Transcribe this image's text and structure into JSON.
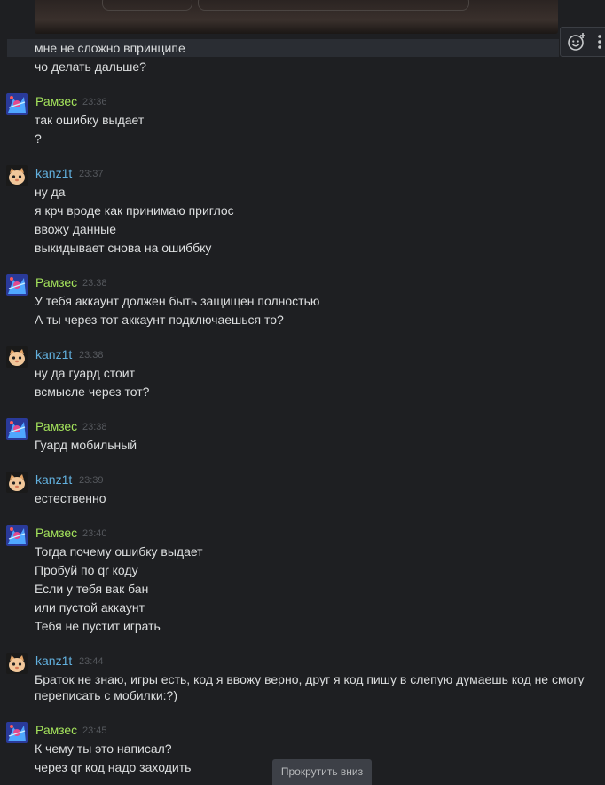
{
  "messages_top": [
    {
      "text": "мне не сложно впринципе"
    },
    {
      "text": "чо делать дальше?"
    }
  ],
  "groups": [
    {
      "author": "Рамзес",
      "time": "23:36",
      "lines": [
        "так ошибку выдает",
        "?"
      ]
    },
    {
      "author": "kanz1t",
      "time": "23:37",
      "lines": [
        "ну да",
        "я крч вроде как принимаю приглос",
        "ввожу данные",
        "выкидывает снова на ошиббку"
      ]
    },
    {
      "author": "Рамзес",
      "time": "23:38",
      "lines": [
        "У тебя аккаунт должен быть защищен полностью",
        "А ты через тот аккаунт подключаешься то?"
      ]
    },
    {
      "author": "kanz1t",
      "time": "23:38",
      "lines": [
        "ну да гуард стоит",
        "всмысле через тот?"
      ]
    },
    {
      "author": "Рамзес",
      "time": "23:38",
      "lines": [
        "Гуард мобильный"
      ]
    },
    {
      "author": "kanz1t",
      "time": "23:39",
      "lines": [
        "естественно"
      ]
    },
    {
      "author": "Рамзес",
      "time": "23:40",
      "lines": [
        "Тогда почему ошибку выдает",
        "Пробуй по qr коду",
        "Если у тебя вак бан",
        "или пустой аккаунт",
        "Тебя не пустит играть"
      ]
    },
    {
      "author": "kanz1t",
      "time": "23:44",
      "lines": [
        "Браток не знаю, игры есть, код я ввожу верно, друг я код пишу в слепую думаешь код не смогу переписать с мобилки:?)"
      ]
    },
    {
      "author": "Рамзес",
      "time": "23:45",
      "lines": [
        "К чему ты это написал?",
        "через qr код надо заходить"
      ]
    }
  ],
  "scroll_button": "Прокрутить вниз",
  "colors": {
    "background": "#1e1f22",
    "ramzes_name": "#a4e35c",
    "kanz_name": "#62b0de",
    "text": "#dcdedf",
    "timestamp": "#55585d"
  },
  "icons": {
    "reaction": "add-reaction-icon",
    "more": "more-vertical-icon"
  }
}
